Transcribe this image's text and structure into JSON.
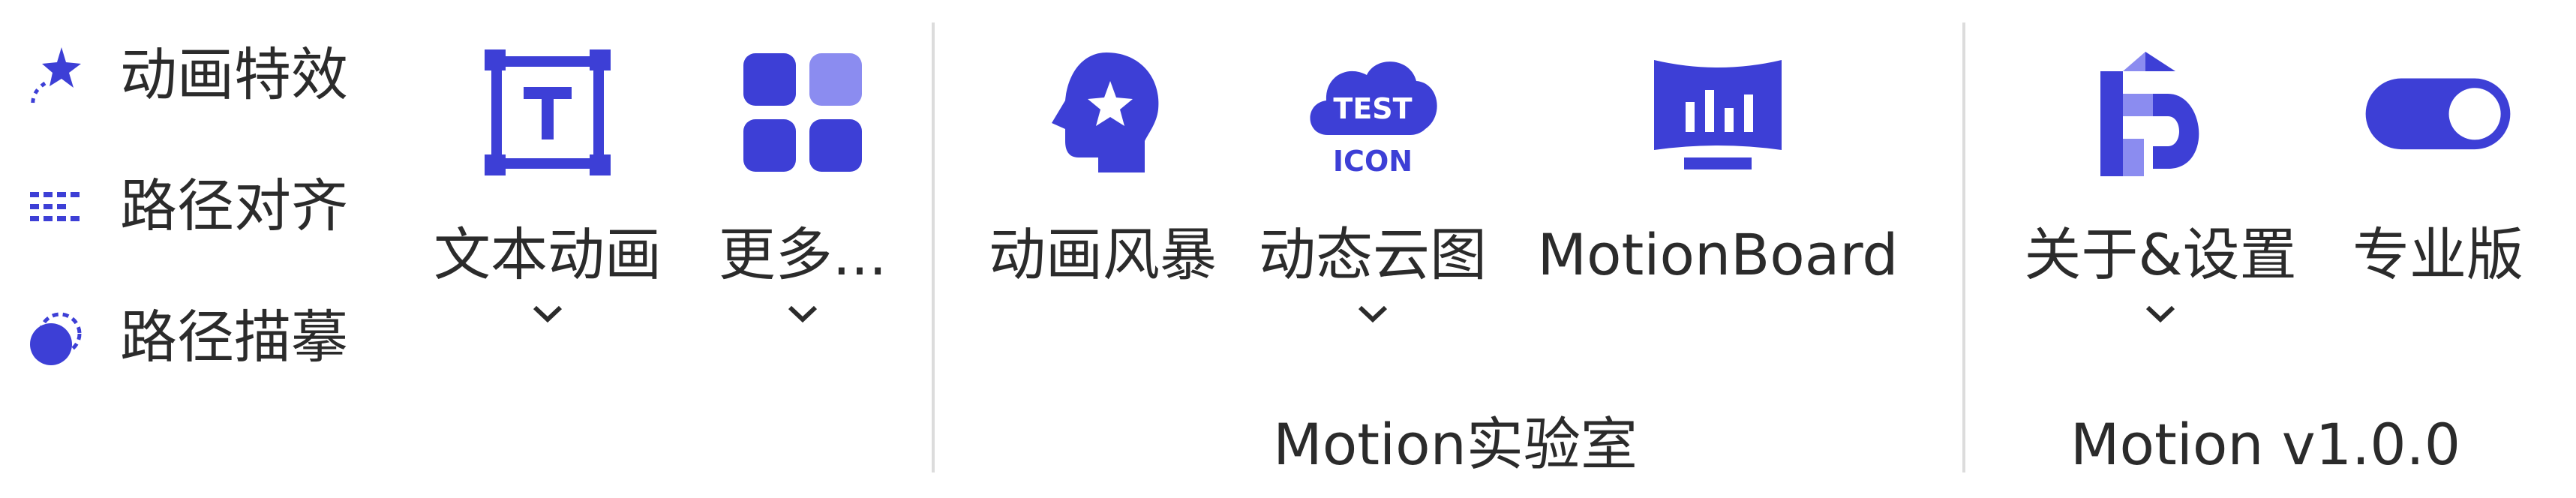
{
  "colors": {
    "accent": "#3d3fd6",
    "accent_light": "#8b8cf0",
    "text": "#2b2b2b",
    "divider": "#dcdcdc"
  },
  "small_buttons": [
    {
      "label": "动画特效",
      "icon": "sparkle-animation-icon"
    },
    {
      "label": "路径对齐",
      "icon": "dotted-align-icon"
    },
    {
      "label": "路径描摹",
      "icon": "path-trace-icon"
    }
  ],
  "big_buttons": {
    "text_animation": {
      "label": "文本动画",
      "icon": "text-frame-icon"
    },
    "more": {
      "label": "更多...",
      "icon": "grid-apps-icon"
    },
    "storm": {
      "label": "动画风暴",
      "icon": "head-star-icon"
    },
    "dynamic_cloud": {
      "label": "动态云图",
      "icon": "cloud-test-icon",
      "icon_text_top": "TEST",
      "icon_text_bottom": "ICON"
    },
    "motion_board": {
      "label": "MotionBoard",
      "icon": "monitor-chart-icon"
    },
    "about_settings": {
      "label": "关于&设置",
      "icon": "md-logo-icon"
    },
    "pro": {
      "label": "专业版",
      "icon": "toggle-icon"
    }
  },
  "groups": {
    "lab": "Motion实验室",
    "version": "Motion v1.0.0"
  }
}
